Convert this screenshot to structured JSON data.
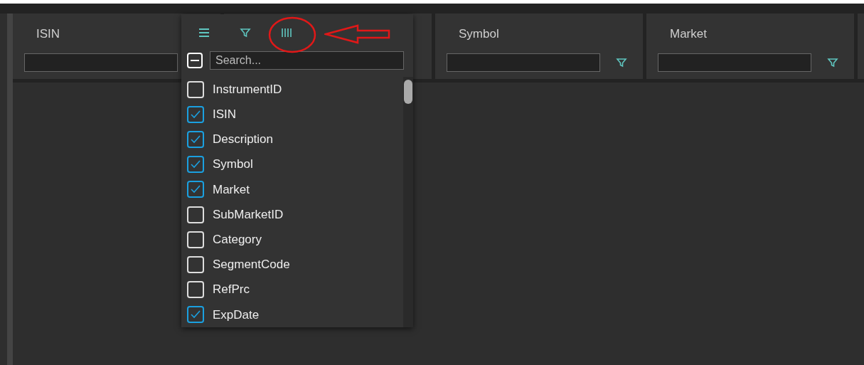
{
  "columns": [
    {
      "kind": "partly_covered",
      "title": "ISIN"
    },
    {
      "kind": "covered"
    },
    {
      "kind": "text",
      "title": "Symbol"
    },
    {
      "kind": "text",
      "title": "Market"
    }
  ],
  "menu": {
    "tabs": [
      {
        "kind": "general"
      },
      {
        "kind": "filter"
      },
      {
        "kind": "columns"
      }
    ],
    "search": {
      "placeholder": "Search..."
    },
    "select_all": {
      "indeterminate": true
    },
    "items": [
      {
        "label": "InstrumentID",
        "checked": false
      },
      {
        "label": "ISIN",
        "checked": true
      },
      {
        "label": "Description",
        "checked": true
      },
      {
        "label": "Symbol",
        "checked": true
      },
      {
        "label": "Market",
        "checked": true
      },
      {
        "label": "SubMarketID",
        "checked": false
      },
      {
        "label": "Category",
        "checked": false
      },
      {
        "label": "SegmentCode",
        "checked": false
      },
      {
        "label": "RefPrc",
        "checked": false
      },
      {
        "label": "ExpDate",
        "checked": true
      }
    ]
  }
}
